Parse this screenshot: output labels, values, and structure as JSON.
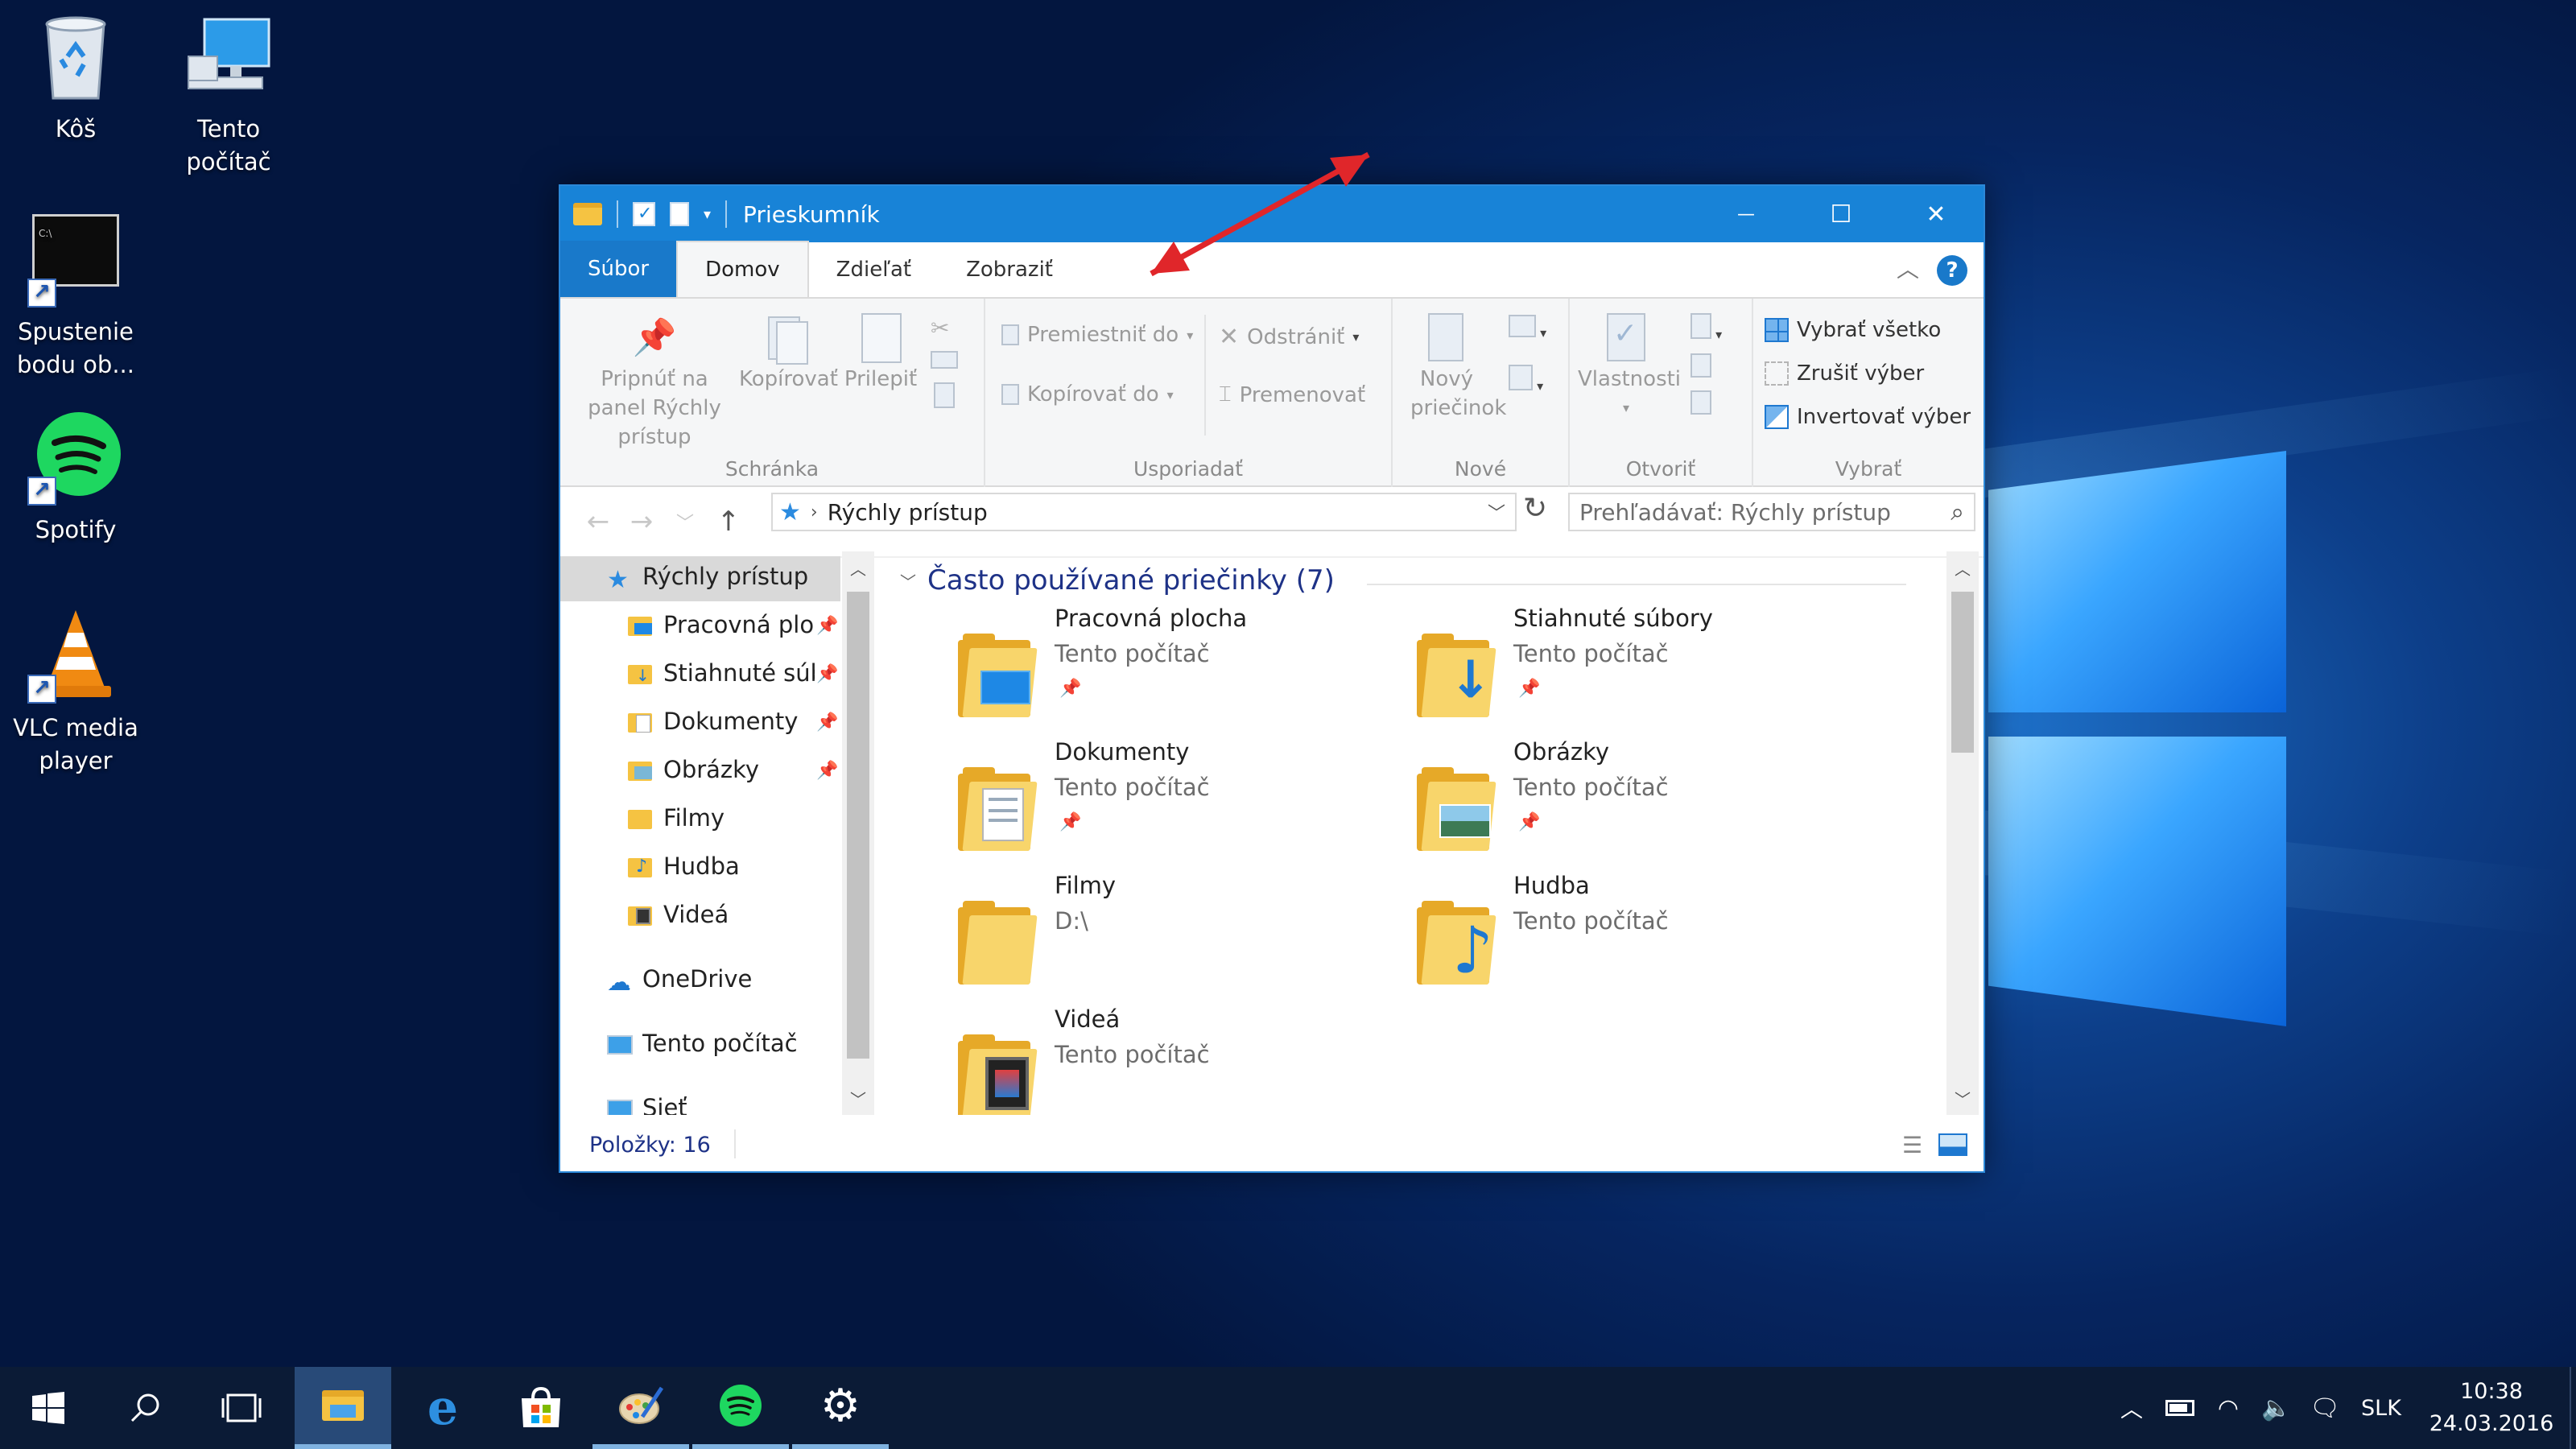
{
  "desktop": {
    "icons": [
      {
        "label": "Kôš"
      },
      {
        "label": "Tento počítač"
      },
      {
        "label": "Spustenie bodu ob..."
      },
      {
        "label": "Spotify"
      },
      {
        "label": "VLC media player"
      }
    ]
  },
  "window": {
    "title": "Prieskumník",
    "controls": {
      "minimize": "—",
      "maximize": "☐",
      "close": "✕"
    },
    "tabs": [
      "Súbor",
      "Domov",
      "Zdieľať",
      "Zobraziť"
    ],
    "help": "?",
    "ribbon": {
      "clipboard": {
        "label": "Schránka",
        "pin": "Pripnúť na panel Rýchly prístup",
        "copy": "Kopírovať",
        "paste": "Prilepiť"
      },
      "organize": {
        "label": "Usporiadať",
        "move_to": "Premiestniť do",
        "copy_to": "Kopírovať do",
        "delete": "Odstrániť",
        "rename": "Premenovať"
      },
      "new": {
        "label": "Nové",
        "new_folder": "Nový priečinok"
      },
      "open": {
        "label": "Otvoriť",
        "properties": "Vlastnosti"
      },
      "select": {
        "label": "Vybrať",
        "select_all": "Vybrať všetko",
        "select_none": "Zrušiť výber",
        "invert": "Invertovať výber"
      }
    },
    "address": "Rýchly prístup",
    "search_placeholder": "Prehľadávať: Rýchly prístup",
    "nav": [
      {
        "label": "Rýchly prístup",
        "pinned": false
      },
      {
        "label": "Pracovná ploc",
        "pinned": true
      },
      {
        "label": "Stiahnuté súb",
        "pinned": true
      },
      {
        "label": "Dokumenty",
        "pinned": true
      },
      {
        "label": "Obrázky",
        "pinned": true
      },
      {
        "label": "Filmy",
        "pinned": false
      },
      {
        "label": "Hudba",
        "pinned": false
      },
      {
        "label": "Videá",
        "pinned": false
      },
      {
        "label": "OneDrive",
        "pinned": false
      },
      {
        "label": "Tento počítač",
        "pinned": false
      },
      {
        "label": "Sieť",
        "pinned": false
      }
    ],
    "section_title": "Často používané priečinky (7)",
    "folders": [
      {
        "name": "Pracovná plocha",
        "location": "Tento počítač",
        "pinned": true
      },
      {
        "name": "Stiahnuté súbory",
        "location": "Tento počítač",
        "pinned": true
      },
      {
        "name": "Dokumenty",
        "location": "Tento počítač",
        "pinned": true
      },
      {
        "name": "Obrázky",
        "location": "Tento počítač",
        "pinned": true
      },
      {
        "name": "Filmy",
        "location": "D:\\",
        "pinned": false
      },
      {
        "name": "Hudba",
        "location": "Tento počítač",
        "pinned": false
      },
      {
        "name": "Videá",
        "location": "Tento počítač",
        "pinned": false
      }
    ],
    "status": "Položky: 16"
  },
  "taskbar": {
    "language": "SLK",
    "time": "10:38",
    "date": "24.03.2016"
  },
  "colors": {
    "title_bar": "#1883d7",
    "file_tab": "#1979ca",
    "annotation_arrow": "#e0262a",
    "taskbar": "#0b1b36"
  }
}
